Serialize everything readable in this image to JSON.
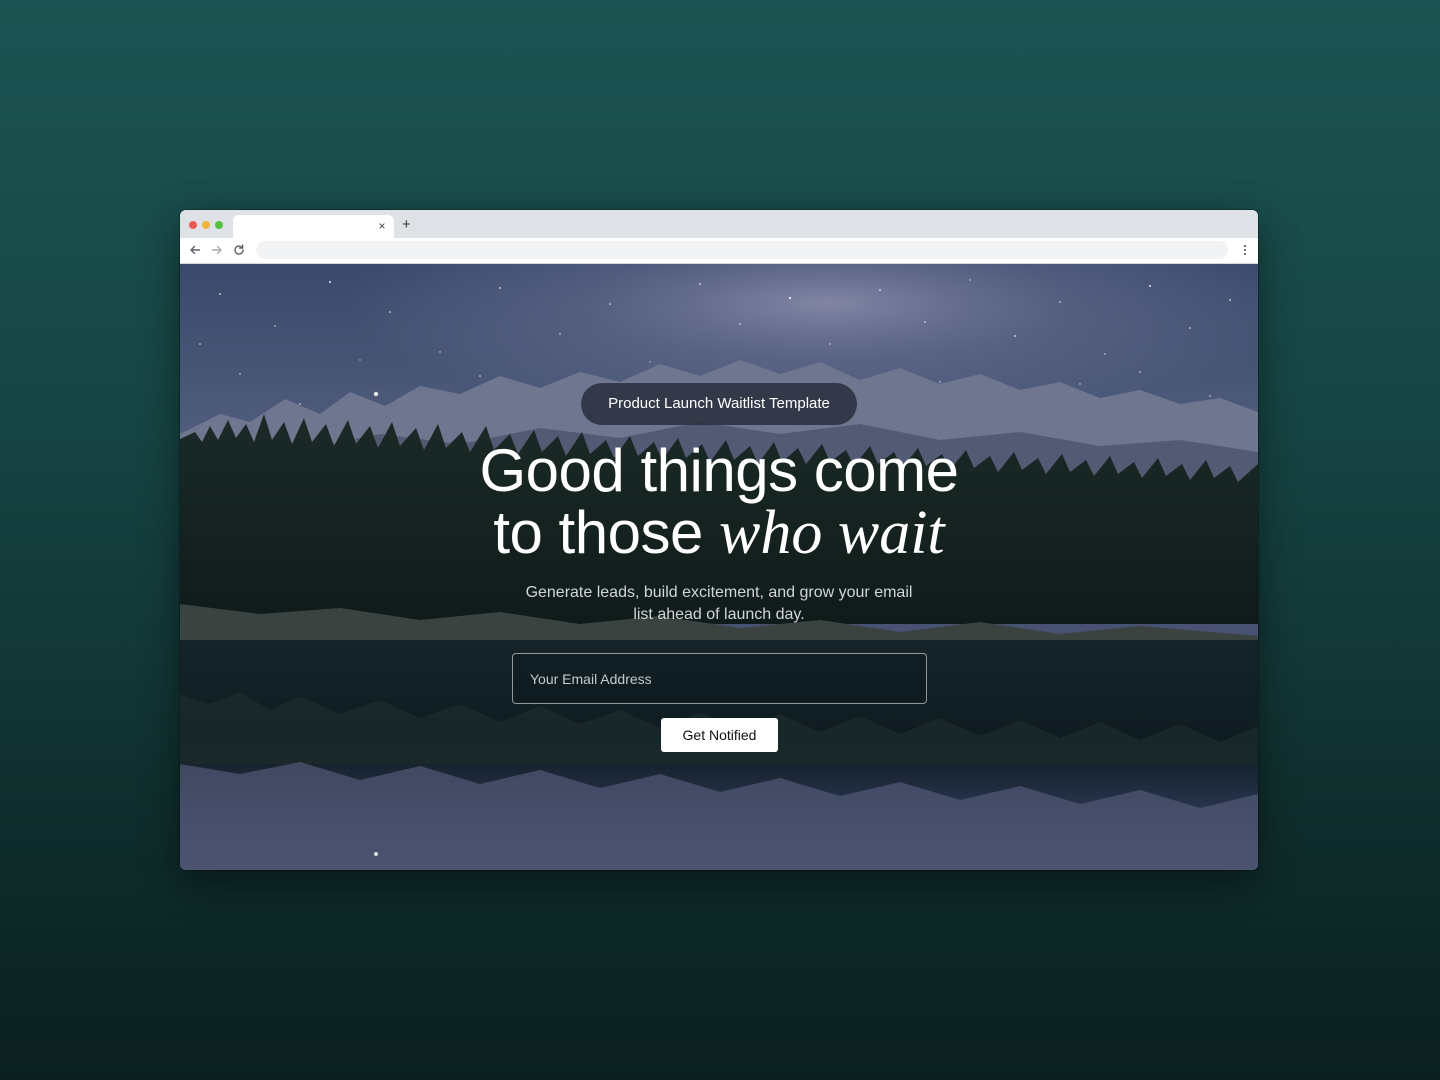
{
  "browser": {
    "tab": {
      "title": "",
      "close_glyph": "×"
    },
    "new_tab_glyph": "+",
    "address_bar": {
      "url": ""
    },
    "icons": {
      "back": "arrow-left-icon",
      "forward": "arrow-right-icon",
      "reload": "reload-icon",
      "menu": "kebab-menu-icon"
    }
  },
  "hero": {
    "badge": "Product Launch Waitlist Template",
    "headline": {
      "line1": "Good things come",
      "line2_plain": "to those",
      "line2_italic": "who wait"
    },
    "subtitle": "Generate leads, build excitement, and grow your email list ahead of launch day.",
    "form": {
      "email_placeholder": "Your Email Address",
      "email_value": "",
      "submit_label": "Get Notified"
    }
  },
  "colors": {
    "page_background_top": "#1c5453",
    "page_background_bottom": "#0b1f1f",
    "badge_background": "#262c38",
    "button_background": "#ffffff",
    "button_text": "#111111"
  }
}
